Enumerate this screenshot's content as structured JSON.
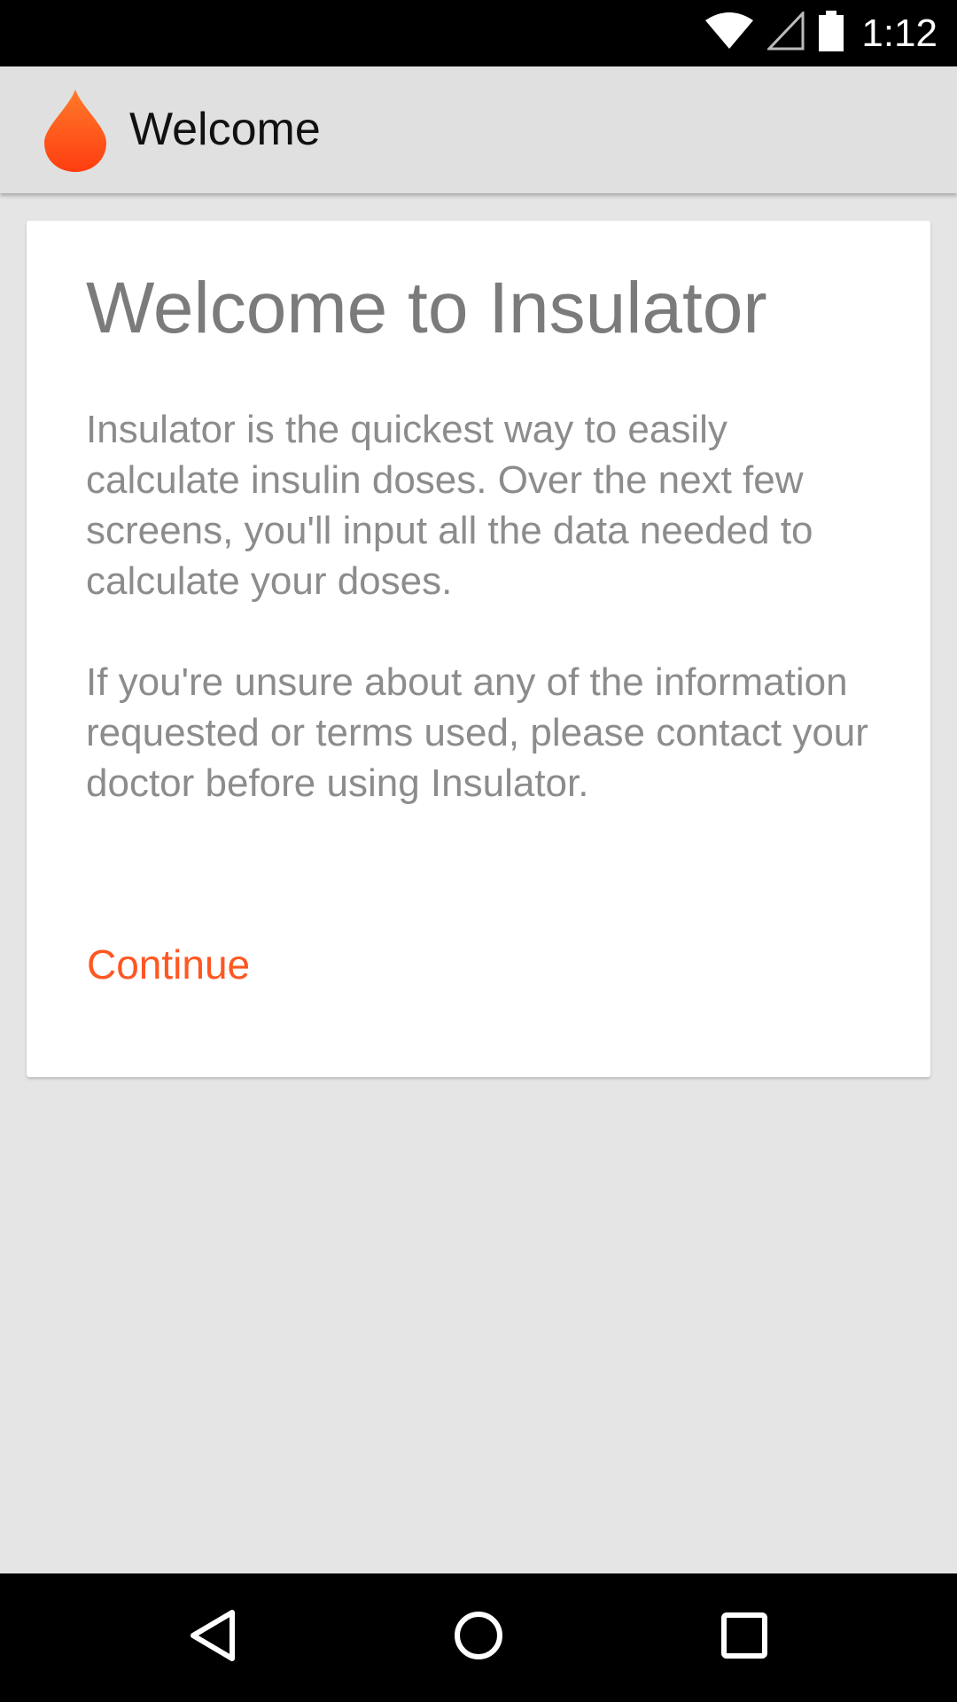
{
  "status_bar": {
    "time": "1:12",
    "icons": [
      "wifi-icon",
      "cell-signal-icon",
      "battery-icon"
    ]
  },
  "app_bar": {
    "title": "Welcome",
    "logo_icon": "blood-drop-icon"
  },
  "card": {
    "title": "Welcome to Insulator",
    "paragraph_1": "Insulator is the quickest way to easily calculate insulin doses. Over the next few screens, you'll input all the data needed to calculate your doses.",
    "paragraph_2": "If you're unsure about any of the information requested or terms used, please contact your doctor before using Insulator.",
    "continue_label": "Continue"
  },
  "nav_bar": {
    "buttons": [
      "back-icon",
      "home-icon",
      "recents-icon"
    ]
  },
  "colors": {
    "accent": "#ff5722",
    "app_bar_bg": "#e0e0e0",
    "page_bg": "#e5e5e5",
    "card_bg": "#ffffff",
    "text_gray": "#8c8c8c"
  }
}
